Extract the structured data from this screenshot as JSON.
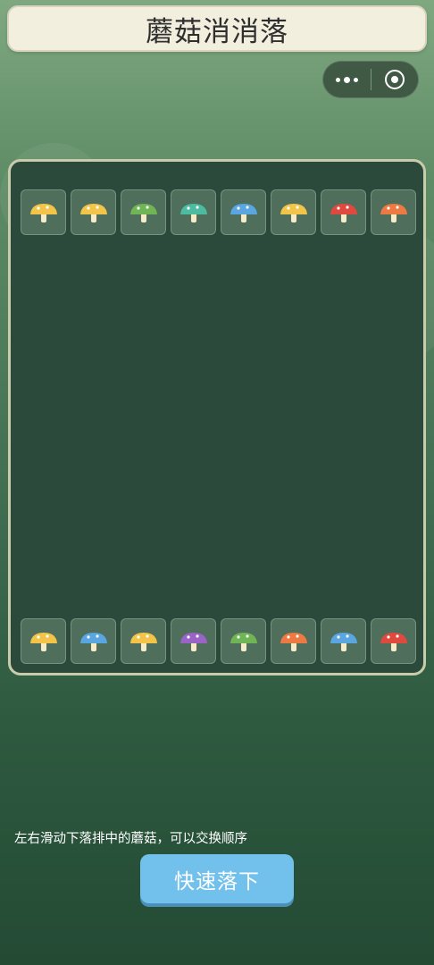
{
  "header": {
    "title": "蘑菇消消落"
  },
  "capsule": {
    "more_icon": "more-dots-icon",
    "close_icon": "target-close-icon"
  },
  "board": {
    "top_row": [
      "yellow",
      "yellow",
      "green",
      "teal",
      "blue",
      "yellow",
      "red",
      "orange"
    ],
    "bottom_row": [
      "yellow",
      "blue",
      "yellow",
      "purple",
      "green",
      "orange",
      "blue",
      "red"
    ]
  },
  "mushroom_colors": {
    "yellow": "#f2c449",
    "green": "#6fb556",
    "teal": "#4dbba0",
    "blue": "#5aa6e0",
    "red": "#e04a3e",
    "orange": "#ec7a42",
    "purple": "#9a63c6"
  },
  "footer": {
    "hint": "左右滑动下落排中的蘑菇，可以交换顺序",
    "drop_button": "快速落下"
  },
  "colors": {
    "accent": "#72c0ec",
    "board": "#2c4a3b",
    "title_bg": "#f3efdf"
  }
}
